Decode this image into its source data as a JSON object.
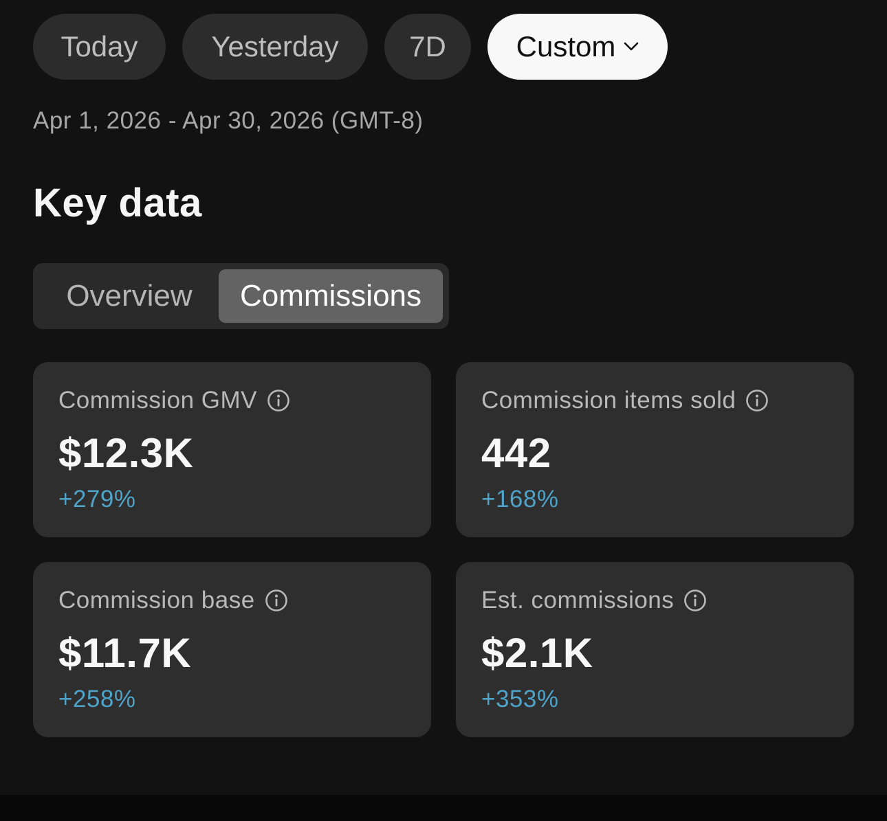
{
  "date_chips": {
    "today": "Today",
    "yesterday": "Yesterday",
    "seven_day": "7D",
    "custom": "Custom",
    "selected": "Custom"
  },
  "date_range": "Apr 1, 2026 - Apr 30, 2026 (GMT-8)",
  "section_title": "Key data",
  "tabs": {
    "overview": "Overview",
    "commissions": "Commissions",
    "selected": "Commissions"
  },
  "metrics": [
    {
      "label": "Commission GMV",
      "value": "$12.3K",
      "change": "+279%"
    },
    {
      "label": "Commission items sold",
      "value": "442",
      "change": "+168%"
    },
    {
      "label": "Commission base",
      "value": "$11.7K",
      "change": "+258%"
    },
    {
      "label": "Est. commissions",
      "value": "$2.1K",
      "change": "+353%"
    }
  ],
  "icons": {
    "info": "info-icon",
    "dropdown": "chevron-down-icon"
  },
  "colors": {
    "background": "#121212",
    "card": "#2e2e2e",
    "positive_change": "#4fa3c9",
    "selected_chip": "#f8f8f8"
  }
}
